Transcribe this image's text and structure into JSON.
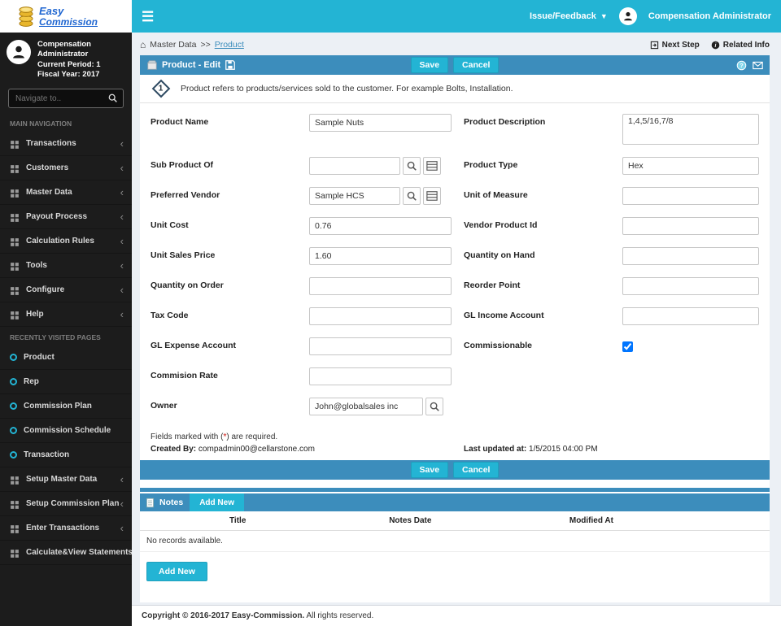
{
  "colors": {
    "cyan": "#23b4d4",
    "header_blue": "#3c8dbc",
    "sidebar_dark": "#1c1c1c"
  },
  "logo": {
    "line1": "Easy",
    "line2": "Commission"
  },
  "topbar": {
    "issue_feedback": "Issue/Feedback",
    "user": "Compensation Administrator"
  },
  "sidebar": {
    "profile": {
      "name": "Compensation Administrator",
      "period": "Current Period: 1",
      "fiscal": "Fiscal Year: 2017"
    },
    "search_placeholder": "Navigate to..",
    "sections": {
      "main": "MAIN NAVIGATION",
      "recent": "RECENTLY VISITED PAGES"
    },
    "nav_items": [
      "Transactions",
      "Customers",
      "Master Data",
      "Payout Process",
      "Calculation Rules",
      "Tools",
      "Configure",
      "Help"
    ],
    "recent_items": [
      "Product",
      "Rep",
      "Commission Plan",
      "Commission Schedule",
      "Transaction"
    ],
    "bottom_items": [
      "Setup Master Data",
      "Setup Commission Plan",
      "Enter Transactions",
      "Calculate&View Statements"
    ]
  },
  "breadcrumb": {
    "root": "Master Data",
    "sep": ">>",
    "current": "Product",
    "next_step": "Next Step",
    "related_info": "Related Info"
  },
  "header": {
    "title": "Product - Edit",
    "save": "Save",
    "cancel": "Cancel"
  },
  "info_note": {
    "number": "1",
    "text": "Product refers to products/services sold to the customer. For example Bolts, Installation."
  },
  "form": {
    "left": [
      {
        "label": "Product Name",
        "value": "Sample Nuts"
      },
      {
        "label": "Sub Product Of",
        "value": "",
        "icons": [
          "search-icon",
          "lookup-list-icon"
        ]
      },
      {
        "label": "Preferred Vendor",
        "value": "Sample HCS",
        "icons": [
          "search-icon",
          "lookup-list-icon"
        ]
      },
      {
        "label": "Unit Cost",
        "value": "0.76"
      },
      {
        "label": "Unit Sales Price",
        "value": "1.60"
      },
      {
        "label": "Quantity on Order",
        "value": ""
      },
      {
        "label": "Tax Code",
        "value": ""
      },
      {
        "label": "GL Expense Account",
        "value": ""
      },
      {
        "label": "Commision Rate",
        "value": ""
      },
      {
        "label": "Owner",
        "value": "John@globalsales inc",
        "icons": [
          "search-icon"
        ]
      }
    ],
    "right": [
      {
        "label": "Product Description",
        "value": "1,4,5/16,7/8",
        "type": "textarea"
      },
      {
        "label": "Product Type",
        "value": "Hex"
      },
      {
        "label": "Unit of Measure",
        "value": ""
      },
      {
        "label": "Vendor Product Id",
        "value": ""
      },
      {
        "label": "Quantity on Hand",
        "value": ""
      },
      {
        "label": "Reorder Point",
        "value": ""
      },
      {
        "label": "GL Income Account",
        "value": ""
      },
      {
        "label": "Commissionable",
        "type": "checkbox",
        "checked": true
      }
    ]
  },
  "footer_meta": {
    "required_pre": "Fields marked with (",
    "required_star": "*",
    "required_post": ") are required.",
    "created_label": "Created By:",
    "created_value": "compadmin00@cellarstone.com",
    "updated_label": "Last updated at:",
    "updated_value": "1/5/2015 04:00 PM"
  },
  "notes": {
    "title": "Notes",
    "add_new": "Add New",
    "columns": [
      "Title",
      "Notes Date",
      "Modified At"
    ],
    "empty": "No records available."
  },
  "copyright": {
    "strong": "Copyright © 2016-2017 Easy-Commission.",
    "normal": "All rights reserved."
  }
}
